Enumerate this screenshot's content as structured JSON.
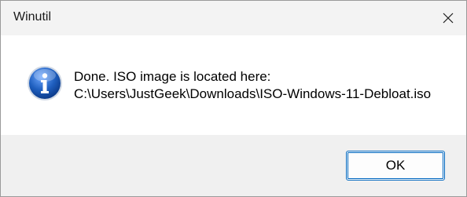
{
  "dialog": {
    "title": "Winutil",
    "message_line1": "Done. ISO image is located here:",
    "message_line2": "C:\\Users\\JustGeek\\Downloads\\ISO-Windows-11-Debloat.iso",
    "ok_label": "OK",
    "icon": "info-icon",
    "close_icon": "close-icon"
  },
  "colors": {
    "accent": "#0067c0",
    "footer_bg": "#f0f0f0",
    "info_icon_blue": "#1f5fbf"
  }
}
